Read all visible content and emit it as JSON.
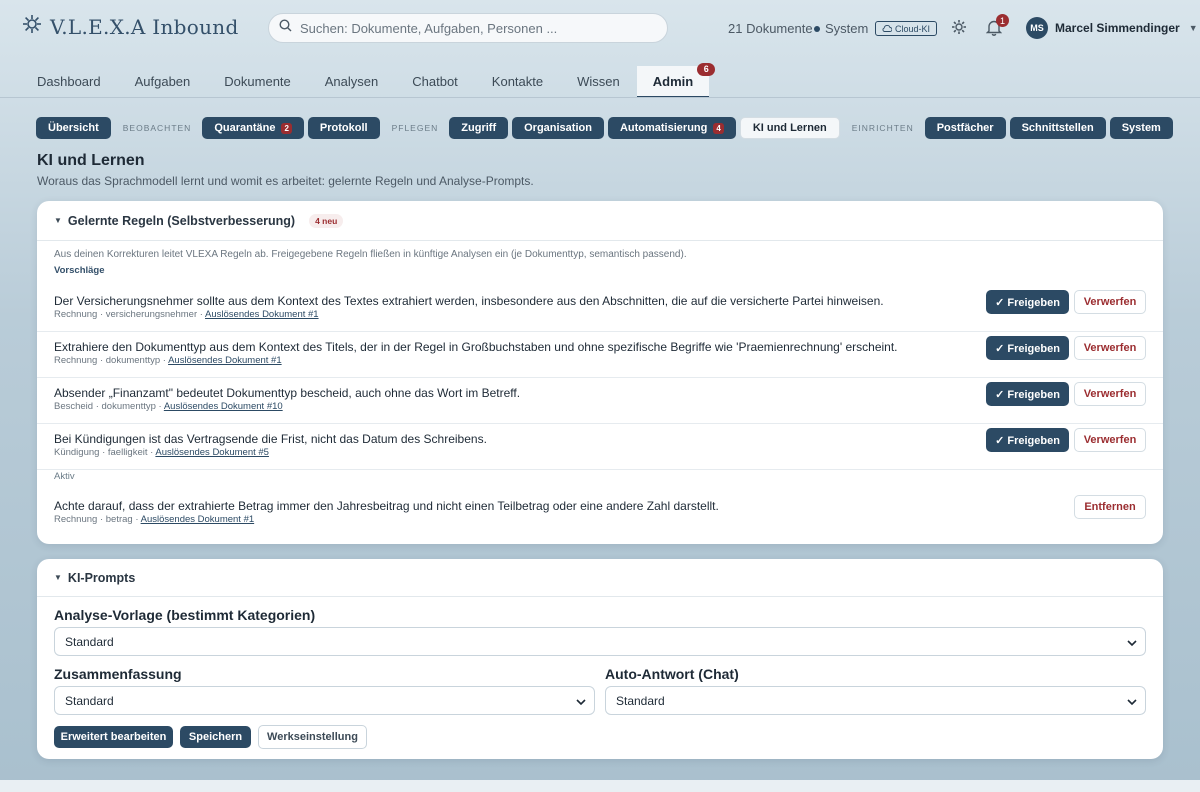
{
  "app": {
    "title": "V.L.E.X.A Inbound"
  },
  "header": {
    "search_placeholder": "Suchen: Dokumente, Aufgaben, Personen ...",
    "doc_count": "21 Dokumente",
    "system_label": "System",
    "cloud_label": "Cloud-KI",
    "notification_count": "1",
    "user_initials": "MS",
    "user_name": "Marcel Simmendinger"
  },
  "tabs": [
    {
      "label": "Dashboard"
    },
    {
      "label": "Aufgaben"
    },
    {
      "label": "Dokumente"
    },
    {
      "label": "Analysen"
    },
    {
      "label": "Chatbot"
    },
    {
      "label": "Kontakte"
    },
    {
      "label": "Wissen"
    },
    {
      "label": "Admin",
      "badge": "6",
      "active": true
    }
  ],
  "subnav": {
    "overview": "Übersicht",
    "group_observe": "BEOBACHTEN",
    "quarantine": "Quarantäne",
    "quarantine_count": "2",
    "protocol": "Protokoll",
    "group_maintain": "PFLEGEN",
    "access": "Zugriff",
    "organisation": "Organisation",
    "automation": "Automatisierung",
    "automation_count": "4",
    "ai_learning": "KI und Lernen",
    "group_setup": "EINRICHTEN",
    "mailboxes": "Postfächer",
    "interfaces": "Schnittstellen",
    "system": "System"
  },
  "page": {
    "title": "KI und Lernen",
    "subtitle": "Woraus das Sprachmodell lernt und womit es arbeitet: gelernte Regeln und Analyse-Prompts."
  },
  "rules_card": {
    "title": "Gelernte Regeln (Selbstverbesserung)",
    "new_badge": "4 neu",
    "intro": "Aus deinen Korrekturen leitet VLEXA Regeln ab. Freigegebene Regeln fließen in künftige Analysen ein (je Dokumenttyp, semantisch passend).",
    "suggestions_label": "Vorschläge",
    "active_label": "Aktiv",
    "approve_label": "✓ Freigeben",
    "reject_label": "Verwerfen",
    "remove_label": "Entfernen",
    "suggestions": [
      {
        "text": "Der Versicherungsnehmer sollte aus dem Kontext des Textes extrahiert werden, insbesondere aus den Abschnitten, die auf die versicherte Partei hinweisen.",
        "meta": "Rechnung · versicherungsnehmer · ",
        "link": "Auslösendes Dokument #1"
      },
      {
        "text": "Extrahiere den Dokumenttyp aus dem Kontext des Titels, der in der Regel in Großbuchstaben und ohne spezifische Begriffe wie 'Praemienrechnung' erscheint.",
        "meta": "Rechnung · dokumenttyp · ",
        "link": "Auslösendes Dokument #1"
      },
      {
        "text": "Absender „Finanzamt\" bedeutet Dokumenttyp bescheid, auch ohne das Wort im Betreff.",
        "meta": "Bescheid · dokumenttyp · ",
        "link": "Auslösendes Dokument #10"
      },
      {
        "text": "Bei Kündigungen ist das Vertragsende die Frist, nicht das Datum des Schreibens.",
        "meta": "Kündigung · faelligkeit · ",
        "link": "Auslösendes Dokument #5"
      }
    ],
    "active": [
      {
        "text": "Achte darauf, dass der extrahierte Betrag immer den Jahresbeitrag und nicht einen Teilbetrag oder eine andere Zahl darstellt.",
        "meta": "Rechnung · betrag · ",
        "link": "Auslösendes Dokument #1"
      }
    ]
  },
  "prompts_card": {
    "title": "KI-Prompts",
    "analysis_label": "Analyse-Vorlage (bestimmt Kategorien)",
    "analysis_value": "Standard",
    "summary_label": "Zusammenfassung",
    "summary_value": "Standard",
    "autoreply_label": "Auto-Antwort (Chat)",
    "autoreply_value": "Standard",
    "advanced_button": "Erweitert bearbeiten",
    "save_button": "Speichern",
    "factory_button": "Werkseinstellung"
  },
  "colors": {
    "primary": "#2c4a64",
    "danger": "#9b2d30"
  }
}
